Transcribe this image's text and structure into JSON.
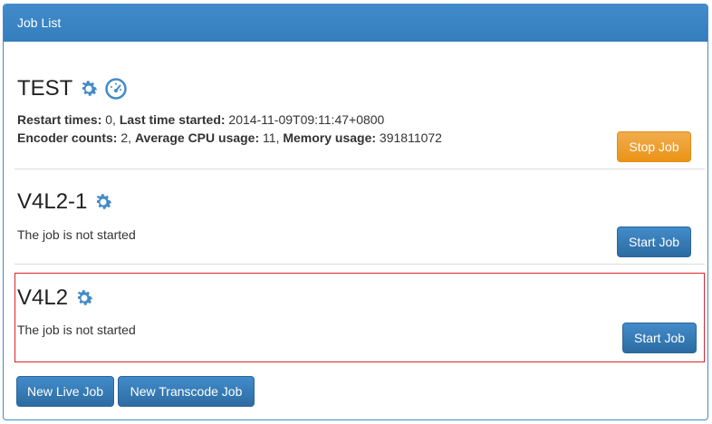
{
  "panel": {
    "title": "Job List"
  },
  "jobs": [
    {
      "name": "TEST",
      "icons": [
        "gear-icon",
        "dashboard-icon"
      ],
      "stats": {
        "restart_label": "Restart times:",
        "restart_value": " 0, ",
        "last_started_label": "Last time started:",
        "last_started_value": " 2014-11-09T09:11:47+0800",
        "encoder_label": "Encoder counts:",
        "encoder_value": " 2, ",
        "cpu_label": "Average CPU usage:",
        "cpu_value": " 11, ",
        "memory_label": "Memory usage:",
        "memory_value": " 391811072"
      },
      "button_label": "Stop Job",
      "button_color": "#f0ad4e"
    },
    {
      "name": "V4L2-1",
      "icons": [
        "gear-icon"
      ],
      "status": "The job is not started",
      "button_label": "Start Job",
      "button_color": "#428bca"
    },
    {
      "name": "V4L2",
      "icons": [
        "gear-icon"
      ],
      "status": "The job is not started",
      "button_label": "Start Job",
      "button_color": "#428bca"
    }
  ],
  "footer": {
    "new_live_label": "New Live Job",
    "new_transcode_label": "New Transcode Job"
  },
  "colors": {
    "primary": "#428bca",
    "warning": "#f0ad4e",
    "selected_border": "#d9232d"
  }
}
